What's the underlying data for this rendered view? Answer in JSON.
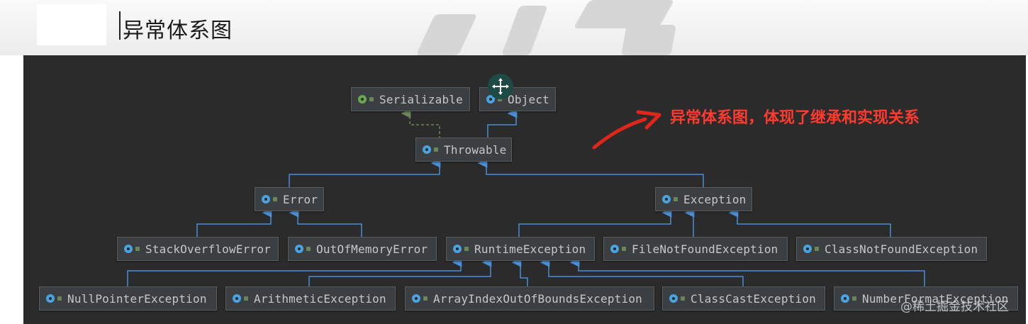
{
  "header": {
    "title": "异常体系图"
  },
  "diagram": {
    "nodes": {
      "serializable": "Serializable",
      "object": "Object",
      "throwable": "Throwable",
      "error": "Error",
      "exception": "Exception",
      "stackoverflow": "StackOverflowError",
      "outofmemory": "OutOfMemoryError",
      "runtime": "RuntimeException",
      "filenotfound": "FileNotFoundException",
      "classnotfound": "ClassNotFoundException",
      "nullpointer": "NullPointerException",
      "arithmetic": "ArithmeticException",
      "arrayindex": "ArrayIndexOutOfBoundsException",
      "classcast": "ClassCastException",
      "numberformat": "NumberFormatException"
    },
    "annotation": "异常体系图，体现了继承和实现关系",
    "credit": "@稀土掘金技术社区"
  },
  "colors": {
    "background": "#2b2b2b",
    "node_fill": "#3c3f41",
    "extends_line": "#4a8fd6",
    "implements_line": "#6a8759",
    "annotation": "#ff3b2f"
  }
}
